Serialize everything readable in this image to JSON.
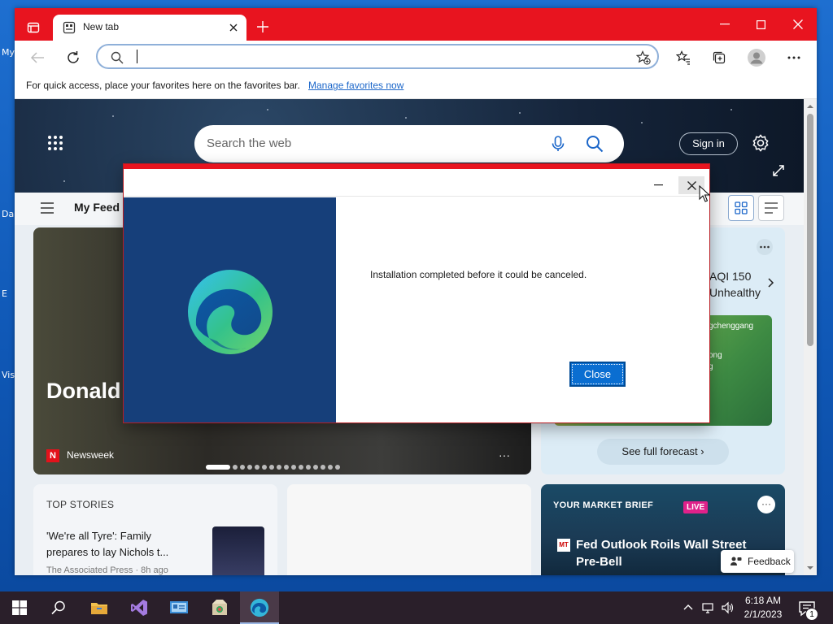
{
  "browser": {
    "tab_title": "New tab",
    "address_value": "",
    "favorites_bar_text": "For quick access, place your favorites here on the favorites bar.",
    "favorites_link": "Manage favorites now"
  },
  "ntp": {
    "search_placeholder": "Search the web",
    "signin_label": "Sign in",
    "feed_label": "My Feed",
    "main_headline": "Donald Trump's Legal Troubles Worsen",
    "main_source": "Newsweek",
    "source_logo_letter": "N",
    "weather_aqi_line1": "AQI 150",
    "weather_aqi_line2": "Unhealthy",
    "weather_map_labels": [
      "gchenggang",
      "ong",
      "g"
    ],
    "forecast_label": "See full forecast",
    "top_stories_label": "TOP STORIES",
    "story_title": "'We're all Tyre': Family prepares to lay Nichols t...",
    "story_source": "The Associated Press · 8h ago",
    "market_label": "YOUR MARKET BRIEF",
    "market_live": "LIVE",
    "market_source_logo": "MT",
    "market_title": "Fed Outlook Roils Wall Street Pre-Bell",
    "feedback_label": "Feedback"
  },
  "dialog": {
    "message": "Installation completed before it could be canceled.",
    "close_button": "Close"
  },
  "taskbar": {
    "time": "6:18 AM",
    "date": "2/1/2023",
    "notification_count": "1"
  },
  "desktop": {
    "fragments": [
      "My",
      "Da",
      "E",
      "Vis"
    ]
  },
  "colors": {
    "edge_titlebar": "#e8141f",
    "accent_blue": "#0a6ed1",
    "taskbar": "#2a1f2a"
  }
}
